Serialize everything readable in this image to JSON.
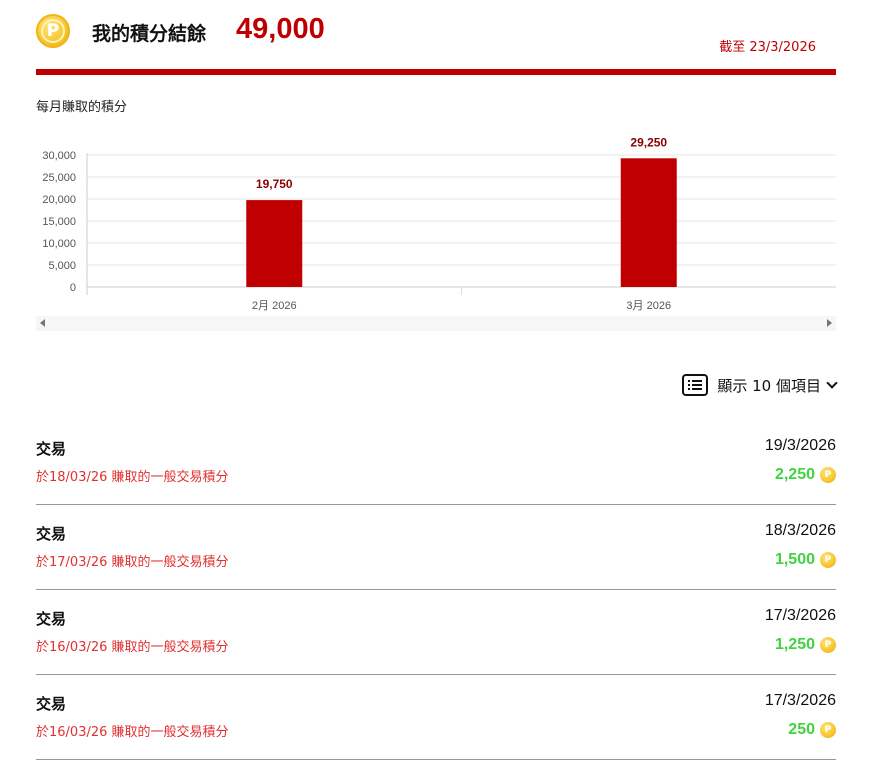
{
  "header": {
    "coin_symbol": "P",
    "balance_label": "我的積分結餘",
    "balance_value": "49,000",
    "as_of": "截至 23/3/2026"
  },
  "chart_section": {
    "title": "每月賺取的積分"
  },
  "chart_data": {
    "type": "bar",
    "categories": [
      "2月 2026",
      "3月 2026"
    ],
    "values": [
      19750,
      29250
    ],
    "data_labels": [
      "19,750",
      "29,250"
    ],
    "yticks": [
      0,
      5000,
      10000,
      15000,
      20000,
      25000,
      30000
    ],
    "ytick_labels": [
      "0",
      "5,000",
      "10,000",
      "15,000",
      "20,000",
      "25,000",
      "30,000"
    ],
    "ylim": [
      0,
      30000
    ],
    "title": "",
    "xlabel": "",
    "ylabel": "",
    "grid": true,
    "bar_color": "#c00000",
    "label_color": "#8b0000"
  },
  "controls": {
    "show_items_label": "顯示 10 個項目"
  },
  "transactions": [
    {
      "type": "交易",
      "description": "於18/03/26 賺取的一般交易積分",
      "date": "19/3/2026",
      "points": "2,250"
    },
    {
      "type": "交易",
      "description": "於17/03/26 賺取的一般交易積分",
      "date": "18/3/2026",
      "points": "1,500"
    },
    {
      "type": "交易",
      "description": "於16/03/26 賺取的一般交易積分",
      "date": "17/3/2026",
      "points": "1,250"
    },
    {
      "type": "交易",
      "description": "於16/03/26 賺取的一般交易積分",
      "date": "17/3/2026",
      "points": "250"
    }
  ],
  "colors": {
    "accent": "#c00000",
    "points_green": "#3fd43f",
    "description_red": "#e03030"
  }
}
